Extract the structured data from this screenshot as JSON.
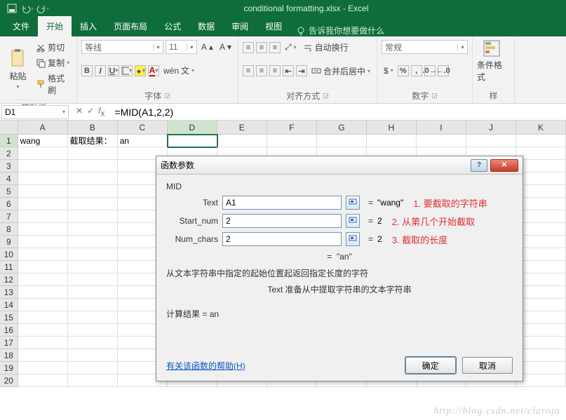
{
  "qat": {
    "title": "conditional formatting.xlsx - Excel"
  },
  "tabs": {
    "file": "文件",
    "home": "开始",
    "insert": "插入",
    "layout": "页面布局",
    "formulas": "公式",
    "data": "数据",
    "review": "审阅",
    "view": "视图",
    "tellme": "告诉我你想要做什么"
  },
  "ribbon": {
    "clipboard": {
      "paste": "粘贴",
      "cut": "剪切",
      "copy": "复制",
      "painter": "格式刷",
      "label": "剪贴板"
    },
    "font": {
      "name": "等线",
      "size": "11",
      "label": "字体"
    },
    "align": {
      "wrap": "自动换行",
      "merge": "合并后居中",
      "label": "对齐方式"
    },
    "number": {
      "format": "常规",
      "label": "数字"
    },
    "styles": {
      "cond": "条件格式",
      "label": "样"
    }
  },
  "namebox": "D1",
  "formula": "=MID(A1,2,2)",
  "columns": [
    "A",
    "B",
    "C",
    "D",
    "E",
    "F",
    "G",
    "H",
    "I",
    "J",
    "K"
  ],
  "cells": {
    "A1": "wang",
    "B1": "截取结果：",
    "C1": "an"
  },
  "dialog": {
    "title": "函数参数",
    "func": "MID",
    "params": [
      {
        "label": "Text",
        "value": "A1",
        "result": "\"wang\""
      },
      {
        "label": "Start_num",
        "value": "2",
        "result": "2"
      },
      {
        "label": "Num_chars",
        "value": "2",
        "result": "2"
      }
    ],
    "anno": [
      "1. 要截取的字符串",
      "2. 从第几个开始截取",
      "3. 截取的长度"
    ],
    "preview_eq": "=",
    "preview": "\"an\"",
    "desc": "从文本字符串中指定的起始位置起返回指定长度的字符",
    "arghelp": "Text  准备从中提取字符串的文本字符串",
    "result_label": "计算结果 = ",
    "result": "an",
    "help": "有关该函数的帮助(H)",
    "ok": "确定",
    "cancel": "取消"
  },
  "watermark": "http://blog.csdn.net/claroja"
}
